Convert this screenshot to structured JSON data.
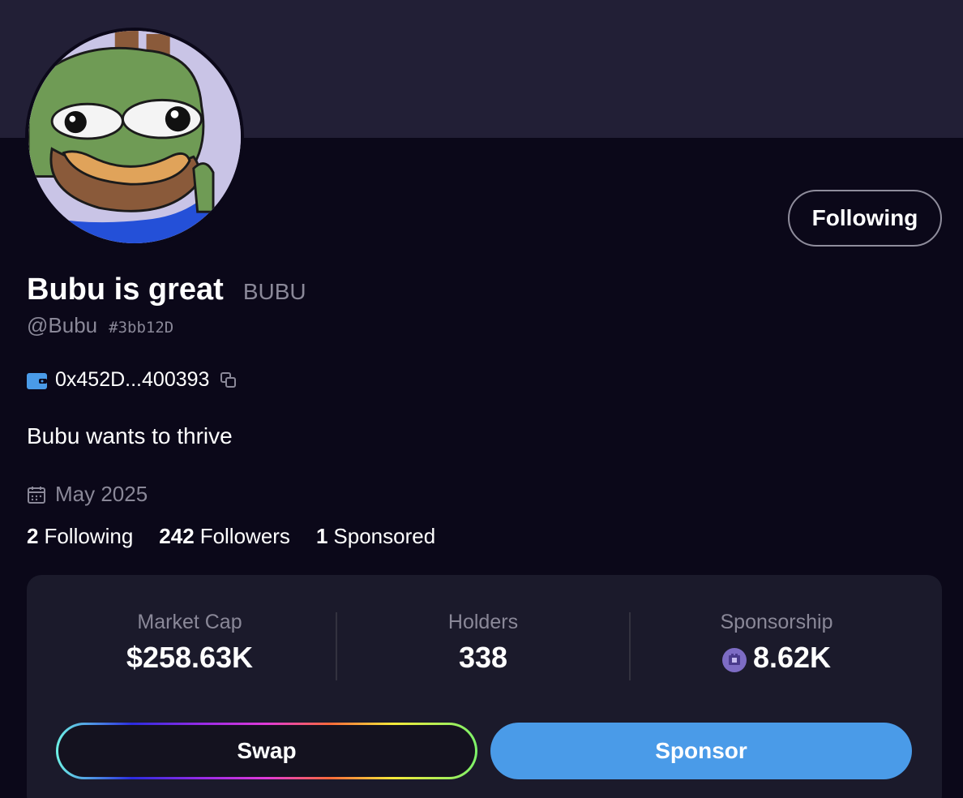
{
  "profile": {
    "display_name": "Bubu is great",
    "ticker": "BUBU",
    "handle": "@Bubu",
    "tag": "#3bb12D",
    "wallet_address": "0x452D...400393",
    "bio": "Bubu wants to thrive",
    "joined": "May 2025",
    "follow_button_label": "Following"
  },
  "stats": [
    {
      "value": "2",
      "label": "Following"
    },
    {
      "value": "242",
      "label": "Followers"
    },
    {
      "value": "1",
      "label": "Sponsored"
    }
  ],
  "metrics": [
    {
      "label": "Market Cap",
      "value": "$258.63K"
    },
    {
      "label": "Holders",
      "value": "338"
    },
    {
      "label": "Sponsorship",
      "value": "8.62K",
      "icon": "coin-icon"
    }
  ],
  "actions": {
    "swap_label": "Swap",
    "sponsor_label": "Sponsor"
  },
  "colors": {
    "background": "#0b0819",
    "banner": "#221f36",
    "card": "#1b1a2b",
    "accent_blue": "#4a9be8",
    "muted_text": "#8a8898"
  },
  "icons": {
    "wallet": "wallet-icon",
    "copy": "copy-icon",
    "calendar": "calendar-icon",
    "sponsorship": "coin-icon"
  }
}
